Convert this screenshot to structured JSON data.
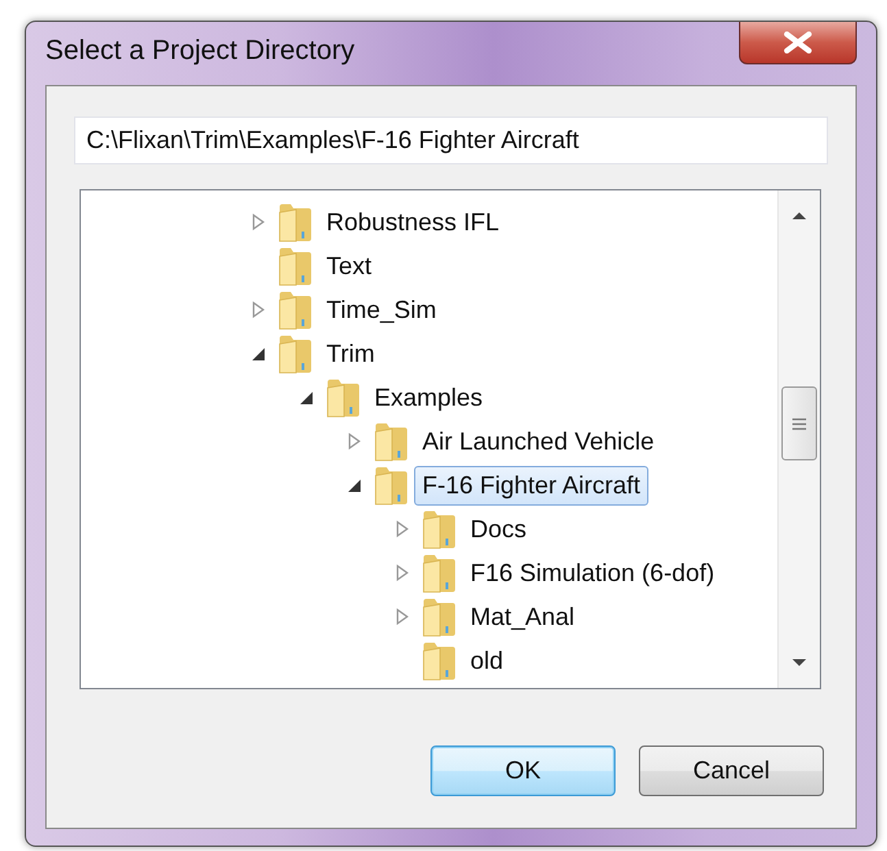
{
  "window": {
    "title": "Select a Project Directory"
  },
  "path_field": {
    "value": "C:\\Flixan\\Trim\\Examples\\F-16 Fighter Aircraft"
  },
  "tree": {
    "items": [
      {
        "label": "Robustness IFL",
        "expandable": true,
        "expanded": false,
        "selected": false
      },
      {
        "label": "Text",
        "expandable": false,
        "selected": false
      },
      {
        "label": "Time_Sim",
        "expandable": true,
        "expanded": false,
        "selected": false
      },
      {
        "label": "Trim",
        "expandable": true,
        "expanded": true,
        "selected": false,
        "children": [
          {
            "label": "Examples",
            "expandable": true,
            "expanded": true,
            "selected": false,
            "children": [
              {
                "label": "Air Launched Vehicle",
                "expandable": true,
                "expanded": false,
                "selected": false
              },
              {
                "label": "F-16 Fighter Aircraft",
                "expandable": true,
                "expanded": true,
                "selected": true,
                "children": [
                  {
                    "label": "Docs",
                    "expandable": true,
                    "expanded": false,
                    "selected": false
                  },
                  {
                    "label": "F16 Simulation (6-dof)",
                    "expandable": true,
                    "expanded": false,
                    "selected": false
                  },
                  {
                    "label": "Mat_Anal",
                    "expandable": true,
                    "expanded": false,
                    "selected": false
                  },
                  {
                    "label": "old",
                    "expandable": false,
                    "selected": false
                  }
                ]
              }
            ]
          }
        ]
      }
    ]
  },
  "buttons": [
    {
      "label": "OK",
      "kind": "default"
    },
    {
      "label": "Cancel",
      "kind": "normal"
    }
  ]
}
